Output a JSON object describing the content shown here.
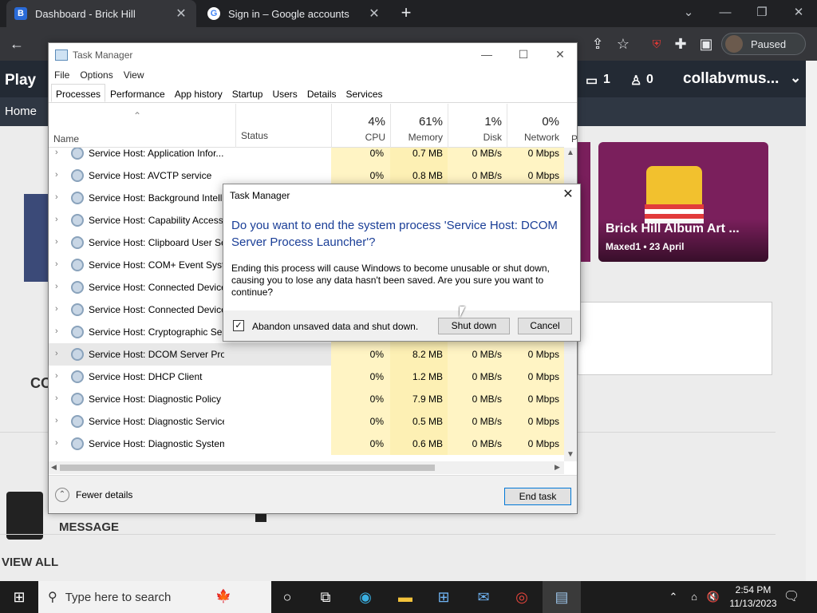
{
  "browser": {
    "tabs": [
      {
        "title": "Dashboard - Brick Hill",
        "favicon": "B"
      },
      {
        "title": "Sign in – Google accounts",
        "favicon": "G"
      }
    ],
    "profile_label": "Paused"
  },
  "website": {
    "nav_play": "Play",
    "nav_counts": [
      "1",
      "0"
    ],
    "nav_user": "collabvmus...",
    "sub_home": "Home",
    "album_title": "Brick Hill Album Art ...",
    "album_meta": "Maxed1 • 23 April",
    "left_partial": "CO",
    "message_label": "MESSAGE",
    "view_all": "VIEW ALL"
  },
  "task_manager": {
    "title": "Task Manager",
    "menu": [
      "File",
      "Options",
      "View"
    ],
    "tabs": [
      "Processes",
      "Performance",
      "App history",
      "Startup",
      "Users",
      "Details",
      "Services"
    ],
    "columns": {
      "name": "Name",
      "status": "Status",
      "cpu": {
        "pct": "4%",
        "label": "CPU"
      },
      "memory": {
        "pct": "61%",
        "label": "Memory"
      },
      "disk": {
        "pct": "1%",
        "label": "Disk"
      },
      "network": {
        "pct": "0%",
        "label": "Network"
      },
      "power_partial": "P"
    },
    "rows": [
      {
        "name": "Service Host: Application Infor...",
        "cpu": "0%",
        "mem": "0.7 MB",
        "disk": "0 MB/s",
        "net": "0 Mbps"
      },
      {
        "name": "Service Host: AVCTP service",
        "cpu": "0%",
        "mem": "0.8 MB",
        "disk": "0 MB/s",
        "net": "0 Mbps"
      },
      {
        "name": "Service Host: Background Intelli",
        "cpu": "",
        "mem": "",
        "disk": "",
        "net": ""
      },
      {
        "name": "Service Host: Capability Access",
        "cpu": "",
        "mem": "",
        "disk": "",
        "net": ""
      },
      {
        "name": "Service Host: Clipboard User Ser",
        "cpu": "",
        "mem": "",
        "disk": "",
        "net": ""
      },
      {
        "name": "Service Host: COM+ Event Syste",
        "cpu": "",
        "mem": "",
        "disk": "",
        "net": ""
      },
      {
        "name": "Service Host: Connected Device",
        "cpu": "",
        "mem": "",
        "disk": "",
        "net": ""
      },
      {
        "name": "Service Host: Connected Device",
        "cpu": "",
        "mem": "",
        "disk": "",
        "net": ""
      },
      {
        "name": "Service Host: Cryptographic Ser",
        "cpu": "",
        "mem": "",
        "disk": "",
        "net": ""
      },
      {
        "name": "Service Host: DCOM Server Proc...",
        "cpu": "0%",
        "mem": "8.2 MB",
        "disk": "0 MB/s",
        "net": "0 Mbps"
      },
      {
        "name": "Service Host: DHCP Client",
        "cpu": "0%",
        "mem": "1.2 MB",
        "disk": "0 MB/s",
        "net": "0 Mbps"
      },
      {
        "name": "Service Host: Diagnostic Policy ...",
        "cpu": "0%",
        "mem": "7.9 MB",
        "disk": "0 MB/s",
        "net": "0 Mbps"
      },
      {
        "name": "Service Host: Diagnostic Service...",
        "cpu": "0%",
        "mem": "0.5 MB",
        "disk": "0 MB/s",
        "net": "0 Mbps"
      },
      {
        "name": "Service Host: Diagnostic System...",
        "cpu": "0%",
        "mem": "0.6 MB",
        "disk": "0 MB/s",
        "net": "0 Mbps"
      }
    ],
    "fewer_details": "Fewer details",
    "end_task": "End task"
  },
  "dialog": {
    "title": "Task Manager",
    "question": "Do you want to end the system process 'Service Host: DCOM Server Process Launcher'?",
    "body": "Ending this process will cause Windows to become unusable or shut down, causing you to lose any data hasn't been saved. Are you sure you want to continue?",
    "checkbox_label": "Abandon unsaved data and shut down.",
    "checkbox_checked": true,
    "shutdown_label": "Shut down",
    "cancel_label": "Cancel"
  },
  "taskbar": {
    "search_placeholder": "Type here to search",
    "time": "2:54 PM",
    "date": "11/13/2023"
  },
  "colors": {
    "dialog_question": "#1a3e97",
    "highlight_col": "#fff4c4",
    "accent_button_border": "#0078d7"
  }
}
